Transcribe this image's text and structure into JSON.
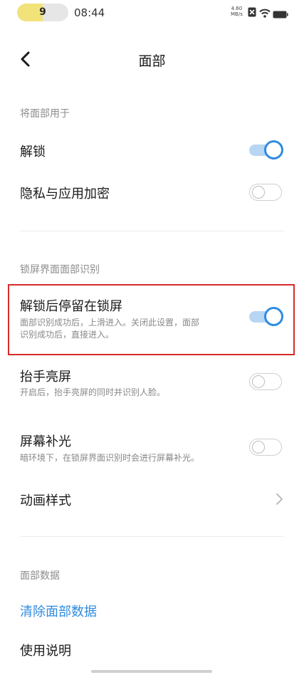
{
  "status_bar": {
    "battery_badge": "9",
    "battery_level_fraction": 0.5,
    "time": "08:44",
    "net_speed_value": "4.60",
    "net_speed_unit": "MB/s"
  },
  "header": {
    "title": "面部",
    "back_icon": "chevron-left-icon"
  },
  "section_use": {
    "label": "将面部用于",
    "items": [
      {
        "label": "解锁",
        "enabled": true
      },
      {
        "label": "隐私与应用加密",
        "enabled": false
      }
    ]
  },
  "section_lock": {
    "label": "锁屏界面面部识别",
    "items": [
      {
        "label": "解锁后停留在锁屏",
        "desc_line1": "面部识别成功后，上滑进入。关闭此设置，面部",
        "desc_line2": "识别成功后，直接进入。",
        "enabled": true,
        "highlighted": true
      },
      {
        "label": "抬手亮屏",
        "desc_line1": "开启后，抬手亮屏的同时并识别人脸。",
        "enabled": false
      },
      {
        "label": "屏幕补光",
        "desc_line1": "暗环境下，在锁屏界面识别时会进行屏幕补光。",
        "enabled": false
      }
    ],
    "animation_style": {
      "label": "动画样式",
      "icon": "chevron-right-icon"
    }
  },
  "section_data": {
    "label": "面部数据",
    "clear": "清除面部数据",
    "help": "使用说明"
  },
  "colors": {
    "accent": "#2f8be0",
    "highlight_border": "#d62a2a",
    "toggle_on_track": "#b7d6f4"
  }
}
